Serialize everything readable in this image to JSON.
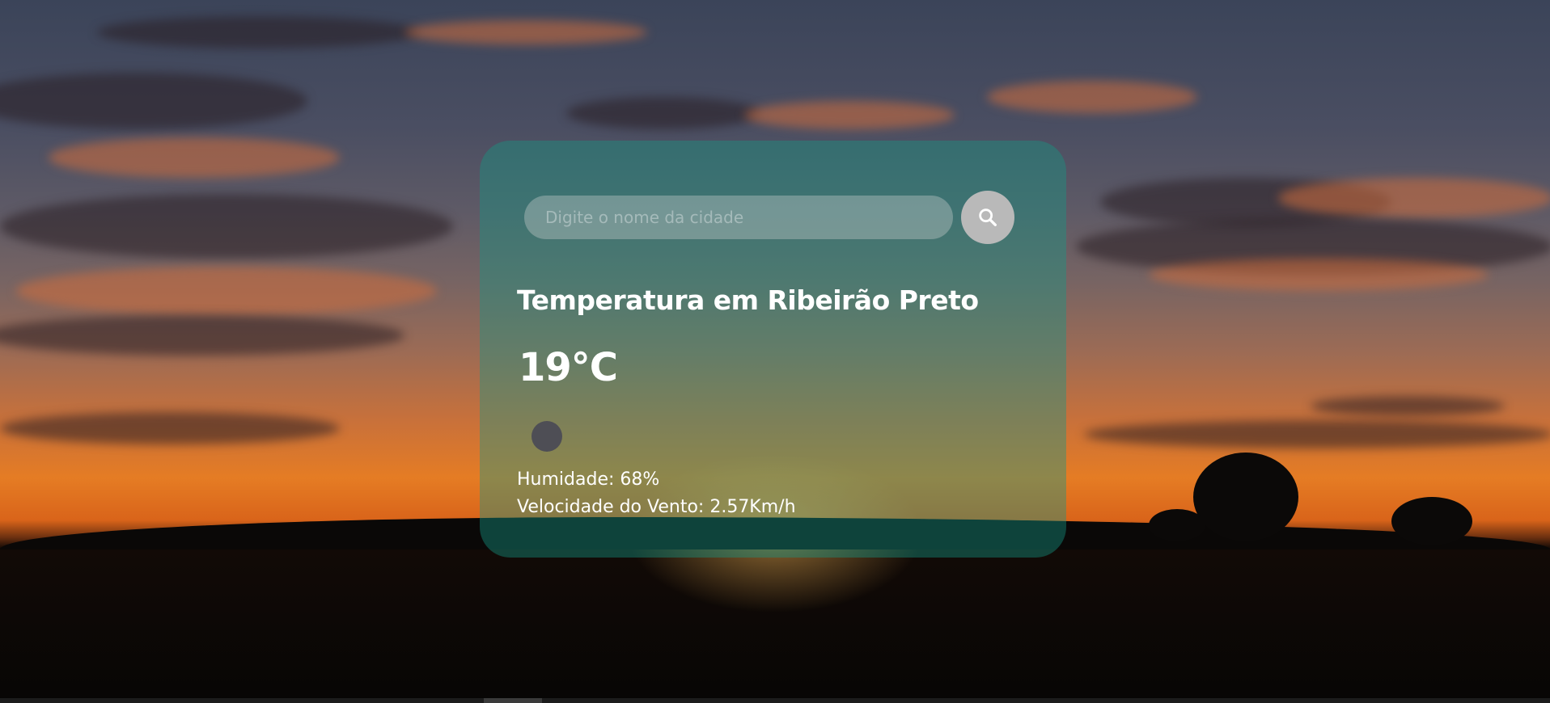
{
  "search": {
    "placeholder": "Digite o nome da cidade",
    "icon": "search-icon"
  },
  "weather": {
    "title": "Temperatura em Ribeirão Preto",
    "temperature": "19°C",
    "humidity": "Humidade: 68%",
    "wind": "Velocidade do Vento: 2.57Km/h",
    "condition_icon": "weather-condition-icon"
  },
  "colors": {
    "card_background": "#1a9682",
    "search_button": "#b9b9b9",
    "text": "#ffffff"
  }
}
